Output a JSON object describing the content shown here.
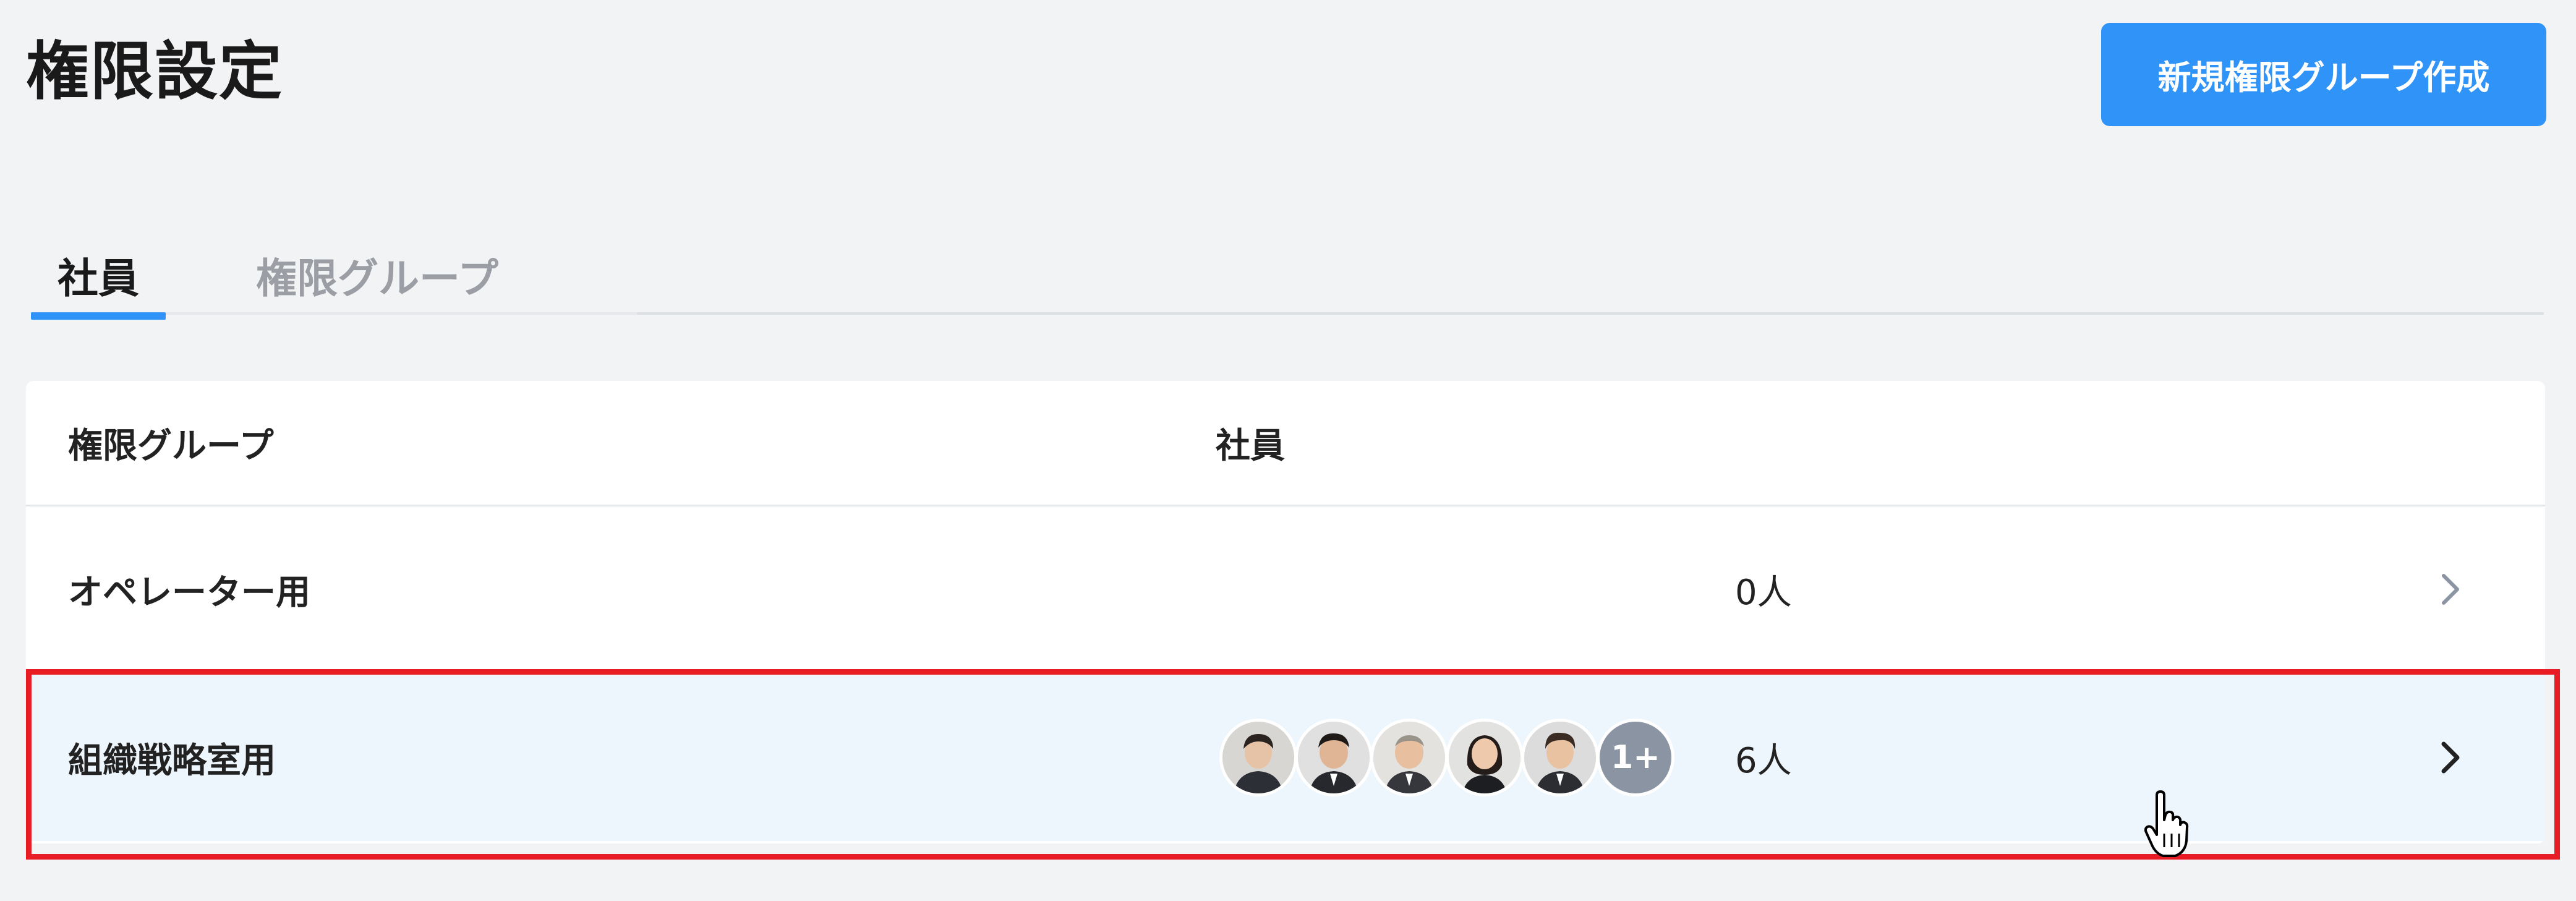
{
  "page": {
    "title": "権限設定"
  },
  "actions": {
    "create_label": "新規権限グループ作成"
  },
  "tabs": [
    {
      "label": "社員",
      "active": true
    },
    {
      "label": "権限グループ",
      "active": false
    }
  ],
  "table": {
    "columns": [
      "権限グループ",
      "社員"
    ],
    "rows": [
      {
        "group": "オペレーター用",
        "count": "0人",
        "avatars": 0
      },
      {
        "group": "組織戦略室用",
        "count": "6人",
        "avatars": 5,
        "more": "1+"
      }
    ]
  },
  "colors": {
    "accent": "#2f93f8",
    "highlight": "#e81c24",
    "selected_row": "#eef6fd"
  }
}
